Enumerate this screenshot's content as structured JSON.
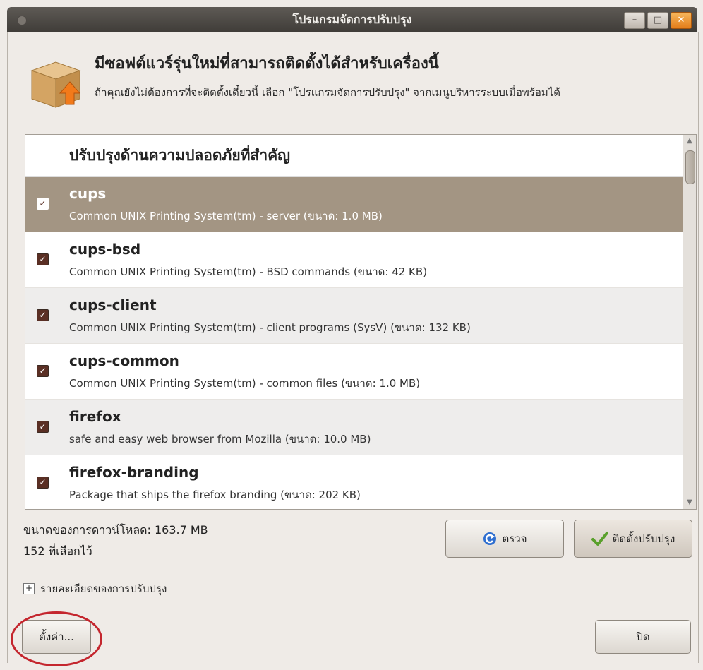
{
  "window": {
    "title": "โปรแกรมจัดการปรับปรุง",
    "controls": [
      "–",
      "□",
      "✕"
    ]
  },
  "header": {
    "headline": "มีซอฟต์แวร์รุ่นใหม่ที่สามารถติดตั้งได้สำหรับเครื่องนี้",
    "subtext": "ถ้าคุณยังไม่ต้องการที่จะติดตั้งเดี๋ยวนี้ เลือก \"โปรแกรมจัดการปรับปรุง\" จากเมนูบริหารระบบเมื่อพร้อมได้"
  },
  "list": {
    "section_title": "ปรับปรุงด้านความปลอดภัยที่สำคัญ",
    "items": [
      {
        "name": "cups",
        "desc": "Common UNIX Printing System(tm) - server (ขนาด: 1.0 MB)",
        "checked": true,
        "selected": true
      },
      {
        "name": "cups-bsd",
        "desc": "Common UNIX Printing System(tm) - BSD commands (ขนาด: 42 KB)",
        "checked": true
      },
      {
        "name": "cups-client",
        "desc": "Common UNIX Printing System(tm) - client programs (SysV) (ขนาด: 132 KB)",
        "checked": true
      },
      {
        "name": "cups-common",
        "desc": "Common UNIX Printing System(tm) - common files (ขนาด: 1.0 MB)",
        "checked": true
      },
      {
        "name": "firefox",
        "desc": "safe and easy web browser from Mozilla (ขนาด: 10.0 MB)",
        "checked": true
      },
      {
        "name": "firefox-branding",
        "desc": "Package that ships the firefox branding (ขนาด: 202 KB)",
        "checked": true
      }
    ]
  },
  "footer": {
    "download_size": "ขนาดของการดาวน์โหลด: 163.7 MB",
    "selected_count": "152 ที่เลือกไว้",
    "check_button": "ตรวจ",
    "install_button": "ติดตั้งปรับปรุง",
    "details_expander": "รายละเอียดของการปรับปรุง",
    "settings_button": "ตั้งค่า...",
    "close_button": "ปิด"
  },
  "colors": {
    "selected_row": "#a39583",
    "checkbox": "#5a2f24",
    "highlight_circle": "#c4262e"
  }
}
